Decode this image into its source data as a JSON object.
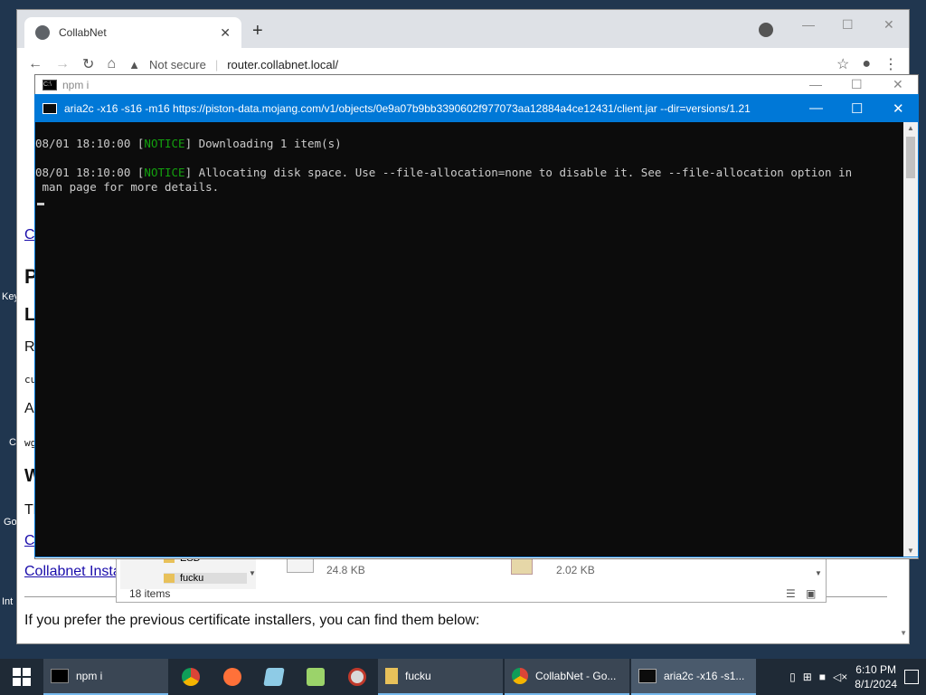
{
  "desktop": {
    "labels": [
      "Key",
      "Co",
      "Go",
      "Int"
    ]
  },
  "chrome": {
    "tab_title": "CollabNet",
    "security_label": "Not secure",
    "url": "router.collabnet.local/",
    "page": {
      "link_c1": "Co",
      "heading_p": "P",
      "heading_l": "L",
      "text_r": "R",
      "text_cu": "cu",
      "text_a": "A",
      "text_wg": "wg",
      "heading_w": "W",
      "text_t": "Th",
      "link_c2": "C",
      "link_installer": "Collabnet Insta",
      "bottom_text": "If you prefer the previous certificate installers, you can find them below:"
    }
  },
  "explorer": {
    "side_items": [
      "ESD",
      "fucku"
    ],
    "files": [
      {
        "size": "24.8 KB"
      },
      {
        "size": "2.02 KB"
      }
    ],
    "status": "18 items"
  },
  "npm_window": {
    "title": "npm i"
  },
  "aria_window": {
    "title": "aria2c  -x16 -s16 -m16 https://piston-data.mojang.com/v1/objects/0e9a07b9bb3390602f977073aa12884a4ce12431/client.jar --dir=versions/1.21",
    "lines": [
      {
        "prefix": "08/01 18:10:00 [",
        "tag": "NOTICE",
        "suffix": "] Downloading 1 item(s)"
      },
      {
        "prefix": "08/01 18:10:00 [",
        "tag": "NOTICE",
        "suffix": "] Allocating disk space. Use --file-allocation=none to disable it. See --file-allocation option in"
      }
    ],
    "wrap_line": " man page for more details."
  },
  "taskbar": {
    "items": [
      {
        "label": "npm i"
      },
      {
        "label": "fucku"
      },
      {
        "label": "CollabNet - Go..."
      },
      {
        "label": "aria2c  -x16 -s1..."
      }
    ],
    "time": "6:10 PM",
    "date": "8/1/2024"
  }
}
